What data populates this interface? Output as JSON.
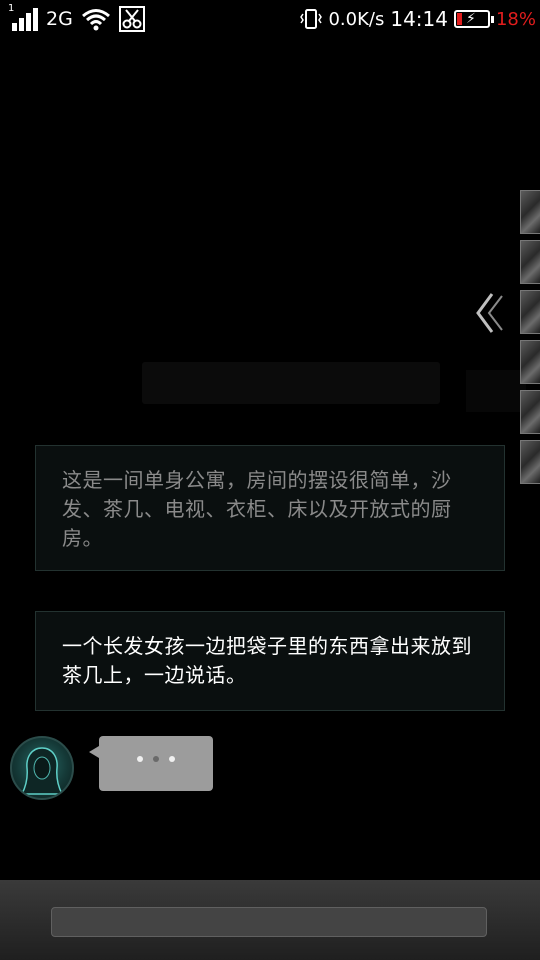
{
  "status_bar": {
    "sim_slot": "1",
    "network_type": "2G",
    "speed": "0.0K/s",
    "time": "14:14",
    "battery_percent": "18%",
    "icons": [
      "signal-icon",
      "wifi-icon",
      "scissors-icon",
      "vibrate-icon",
      "battery-charging-icon"
    ]
  },
  "story": {
    "narration_1": "这是一间单身公寓，房间的摆设很简单，沙发、茶几、电视、衣柜、床以及开放式的厨房。",
    "narration_2": "一个长发女孩一边把袋子里的东西拿出来放到茶几上，一边说话。"
  },
  "chat": {
    "typing_indicator": "typing-dots-icon"
  },
  "side_panel": {
    "thumbnail_count": 6,
    "back_icon": "chevron-left-icon"
  },
  "input": {
    "value": ""
  },
  "colors": {
    "background": "#000000",
    "battery_low": "#e11d1d",
    "box_border": "#233230",
    "bubble": "#9c9c9c"
  }
}
